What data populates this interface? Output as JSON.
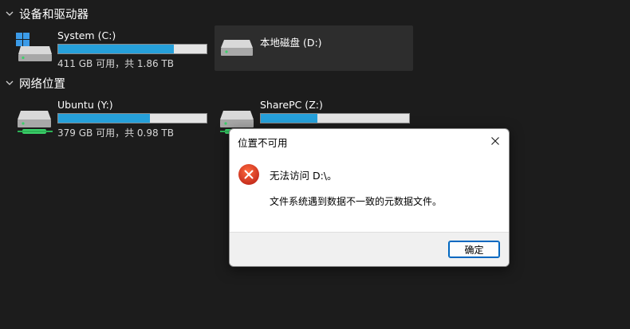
{
  "sections": {
    "devices": {
      "title": "设备和驱动器"
    },
    "network": {
      "title": "网络位置"
    }
  },
  "drives": {
    "c": {
      "name": "System (C:)",
      "info": "411 GB 可用，共 1.86 TB",
      "used_fraction": 0.78,
      "icon": "windows-drive-icon"
    },
    "d": {
      "name": "本地磁盘 (D:)",
      "icon": "hard-drive-icon",
      "selected": true
    },
    "y": {
      "name": "Ubuntu (Y:)",
      "info": "379 GB 可用，共 0.98 TB",
      "used_fraction": 0.62,
      "icon": "network-drive-icon"
    },
    "z": {
      "name": "SharePC (Z:)",
      "info": "",
      "used_fraction": 0.38,
      "icon": "network-drive-icon"
    }
  },
  "dialog": {
    "title": "位置不可用",
    "message": "无法访问 D:\\。",
    "detail": "文件系统遇到数据不一致的元数据文件。",
    "ok_label": "确定",
    "icon": "error-icon",
    "close_icon": "close-icon"
  },
  "colors": {
    "background": "#1c1c1c",
    "bar_fill": "#26a0da",
    "error_red": "#c42b1c",
    "accent": "#0067c0"
  }
}
